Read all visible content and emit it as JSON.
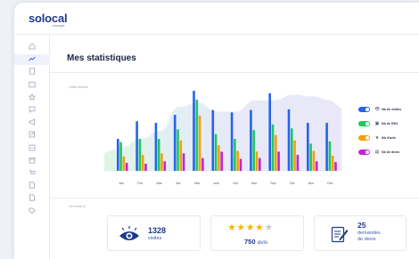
{
  "brand": {
    "name": "solocal",
    "subtitle": "manager"
  },
  "sidebar": {
    "items": [
      {
        "icon": "home-icon",
        "active": false
      },
      {
        "icon": "trend-icon",
        "active": true
      },
      {
        "icon": "page-icon",
        "active": false
      },
      {
        "icon": "image-icon",
        "active": false
      },
      {
        "icon": "star-icon",
        "active": false
      },
      {
        "icon": "message-icon",
        "active": false
      },
      {
        "icon": "megaphone-icon",
        "active": false
      },
      {
        "icon": "edit-icon",
        "active": false
      },
      {
        "icon": "list-icon",
        "active": false
      },
      {
        "icon": "calendar-icon",
        "active": false
      },
      {
        "icon": "cart-icon",
        "active": false
      },
      {
        "icon": "document-icon",
        "active": false
      },
      {
        "icon": "document-icon",
        "active": false
      },
      {
        "icon": "tag-icon",
        "active": false
      }
    ]
  },
  "page": {
    "title": "Mes statistiques",
    "year_label": "Cette année",
    "month_section_label": "Ce mois-ci"
  },
  "legend": [
    {
      "label": "Nb de visites",
      "icon": "eye-icon",
      "glyph": "👁",
      "color": "#2563eb"
    },
    {
      "label": "Nb de RDV",
      "icon": "calendar-icon",
      "glyph": "▣",
      "color": "#22c55e"
    },
    {
      "label": "Nb d'avis",
      "icon": "star-icon",
      "glyph": "★",
      "color": "#f59e0b"
    },
    {
      "label": "Nb de devis",
      "icon": "quote-icon",
      "glyph": "▤",
      "color": "#c026d3"
    }
  ],
  "chart_data": {
    "type": "bar",
    "categories": [
      "Jan",
      "Fév",
      "Mar",
      "Avr",
      "Mai",
      "Juin",
      "Juil",
      "Aoû",
      "Sep",
      "Oct",
      "Nov",
      "Déc"
    ],
    "series": [
      {
        "name": "Nb de visites",
        "color": "#2563eb",
        "values": [
          0.4,
          0.62,
          0.6,
          0.7,
          1.0,
          0.76,
          0.73,
          0.76,
          0.97,
          0.77,
          0.6,
          0.6
        ]
      },
      {
        "name": "Nb de RDV",
        "color": "#22c55e",
        "values": [
          0.36,
          0.4,
          0.4,
          0.52,
          0.89,
          0.46,
          0.4,
          0.51,
          0.58,
          0.53,
          0.34,
          0.37
        ]
      },
      {
        "name": "Nb d'avis",
        "color": "#f59e0b",
        "values": [
          0.18,
          0.2,
          0.22,
          0.38,
          0.69,
          0.32,
          0.25,
          0.24,
          0.45,
          0.38,
          0.25,
          0.19
        ]
      },
      {
        "name": "Nb de devis",
        "color": "#c026d3",
        "values": [
          0.1,
          0.09,
          0.12,
          0.22,
          0.16,
          0.24,
          0.15,
          0.16,
          0.24,
          0.2,
          0.12,
          0.11
        ]
      }
    ],
    "background_area": [
      0.3,
      0.4,
      0.5,
      0.8,
      0.85,
      0.74,
      0.74,
      0.88,
      0.88,
      0.95,
      0.93,
      0.88
    ],
    "grid": false,
    "legend_position": "right"
  },
  "cards": {
    "visits": {
      "value": "1328",
      "label": "visites",
      "icon": "eye-icon"
    },
    "reviews": {
      "stars_on": 4,
      "stars_total": 5,
      "value": "750",
      "label": "avis",
      "icon": "star-icon"
    },
    "quotes": {
      "value": "25",
      "label_line1": "demandes",
      "label_line2": "de devis",
      "icon": "quote-form-icon"
    }
  }
}
